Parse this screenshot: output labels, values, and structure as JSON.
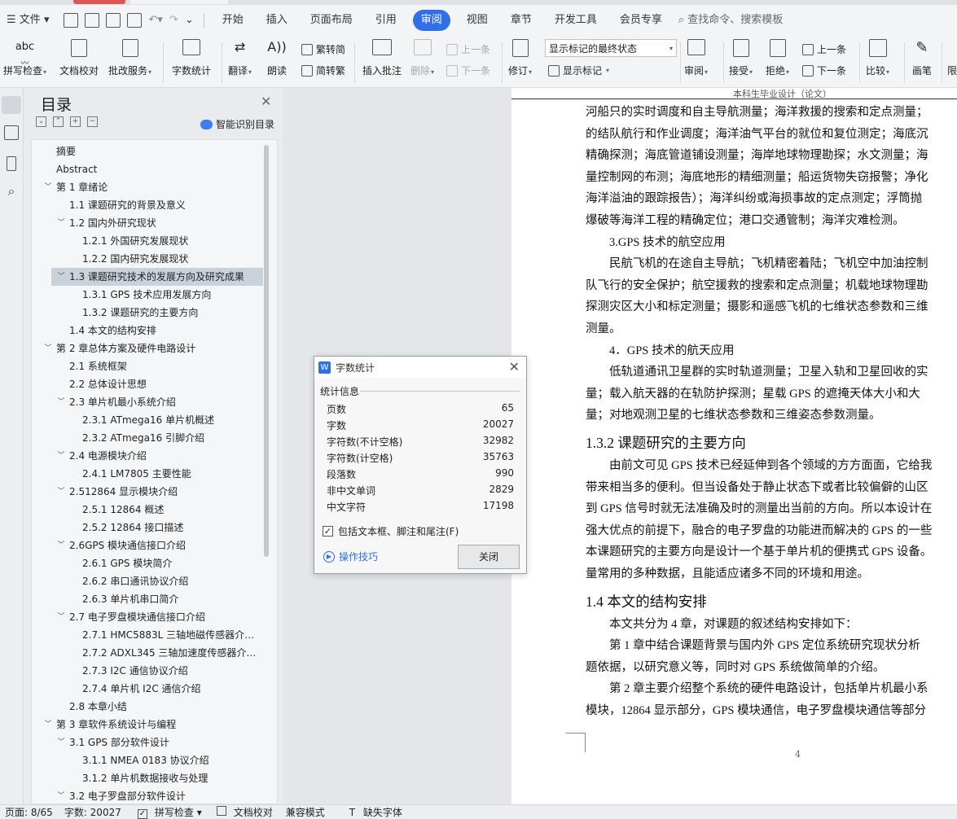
{
  "menubar": {
    "file": "文件",
    "items": [
      "开始",
      "插入",
      "页面布局",
      "引用",
      "审阅",
      "视图",
      "章节",
      "开发工具",
      "会员专享"
    ],
    "active_index": 4,
    "search": "查找命令、搜索模板"
  },
  "ribbon": {
    "spellcheck": "拼写检查",
    "proofread": "文档校对",
    "batch": "批改服务",
    "wordcount": "字数统计",
    "translate": "翻译",
    "read": "朗读",
    "trad_to_simp": "繁转简",
    "simp_to_trad": "简转繁",
    "insert_comment": "插入批注",
    "delete": "删除",
    "prev": "上一条",
    "next": "下一条",
    "revise": "修订",
    "show_select": "显示标记的最终状态",
    "show_markup": "显示标记",
    "review": "审阅",
    "accept": "接受",
    "reject": "拒绝",
    "prev2": "上一条",
    "next2": "下一条",
    "compare": "比较",
    "pen": "画笔",
    "limit": "限"
  },
  "toc": {
    "title": "目录",
    "smart": "智能识别目录",
    "items": [
      {
        "label": "摘要",
        "level": 0,
        "expand": ""
      },
      {
        "label": "Abstract",
        "level": 0,
        "expand": ""
      },
      {
        "label": "第 1 章绪论",
        "level": 0,
        "expand": "v"
      },
      {
        "label": "1.1 课题研究的背景及意义",
        "level": 1,
        "expand": ""
      },
      {
        "label": "1.2 国内外研究现状",
        "level": 1,
        "expand": "v"
      },
      {
        "label": "1.2.1 外国研究发展现状",
        "level": 2,
        "expand": ""
      },
      {
        "label": "1.2.2 国内研究发展现状",
        "level": 2,
        "expand": ""
      },
      {
        "label": "1.3 课题研究技术的发展方向及研究成果",
        "level": 1,
        "expand": "v",
        "selected": true
      },
      {
        "label": "1.3.1 GPS 技术应用发展方向",
        "level": 2,
        "expand": ""
      },
      {
        "label": "1.3.2 课题研究的主要方向",
        "level": 2,
        "expand": ""
      },
      {
        "label": "1.4 本文的结构安排",
        "level": 1,
        "expand": ""
      },
      {
        "label": "第 2 章总体方案及硬件电路设计",
        "level": 0,
        "expand": "v"
      },
      {
        "label": "2.1 系统框架",
        "level": 1,
        "expand": ""
      },
      {
        "label": "2.2 总体设计思想",
        "level": 1,
        "expand": ""
      },
      {
        "label": "2.3 单片机最小系统介绍",
        "level": 1,
        "expand": "v"
      },
      {
        "label": "2.3.1 ATmega16 单片机概述",
        "level": 2,
        "expand": ""
      },
      {
        "label": "2.3.2 ATmega16 引脚介绍",
        "level": 2,
        "expand": ""
      },
      {
        "label": "2.4 电源模块介绍",
        "level": 1,
        "expand": "v"
      },
      {
        "label": "2.4.1 LM7805 主要性能",
        "level": 2,
        "expand": ""
      },
      {
        "label": "2.512864 显示模块介绍",
        "level": 1,
        "expand": "v"
      },
      {
        "label": "2.5.1 12864 概述",
        "level": 2,
        "expand": ""
      },
      {
        "label": "2.5.2 12864 接口描述",
        "level": 2,
        "expand": ""
      },
      {
        "label": "2.6GPS 模块通信接口介绍",
        "level": 1,
        "expand": "v"
      },
      {
        "label": "2.6.1 GPS 模块简介",
        "level": 2,
        "expand": ""
      },
      {
        "label": "2.6.2 串口通讯协议介绍",
        "level": 2,
        "expand": ""
      },
      {
        "label": "2.6.3 单片机串口简介",
        "level": 2,
        "expand": ""
      },
      {
        "label": "2.7 电子罗盘模块通信接口介绍",
        "level": 1,
        "expand": "v"
      },
      {
        "label": "2.7.1 HMC5883L 三轴地磁传感器介…",
        "level": 2,
        "expand": ""
      },
      {
        "label": "2.7.2 ADXL345 三轴加速度传感器介…",
        "level": 2,
        "expand": ""
      },
      {
        "label": "2.7.3 I2C 通信协议介绍",
        "level": 2,
        "expand": ""
      },
      {
        "label": "2.7.4 单片机 I2C 通信介绍",
        "level": 2,
        "expand": ""
      },
      {
        "label": "2.8 本章小结",
        "level": 1,
        "expand": ""
      },
      {
        "label": "第 3 章软件系统设计与编程",
        "level": 0,
        "expand": "v"
      },
      {
        "label": "3.1 GPS 部分软件设计",
        "level": 1,
        "expand": "v"
      },
      {
        "label": "3.1.1 NMEA 0183 协议介绍",
        "level": 2,
        "expand": ""
      },
      {
        "label": "3.1.2 单片机数据接收与处理",
        "level": 2,
        "expand": ""
      },
      {
        "label": "3.2 电子罗盘部分软件设计",
        "level": 1,
        "expand": "v"
      }
    ]
  },
  "dialog": {
    "title": "字数统计",
    "section": "统计信息",
    "stats": [
      {
        "label": "页数",
        "value": "65"
      },
      {
        "label": "字数",
        "value": "20027"
      },
      {
        "label": "字符数(不计空格)",
        "value": "32982"
      },
      {
        "label": "字符数(计空格)",
        "value": "35763"
      },
      {
        "label": "段落数",
        "value": "990"
      },
      {
        "label": "非中文单词",
        "value": "2829"
      },
      {
        "label": "中文字符",
        "value": "17198"
      }
    ],
    "include": "包括文本框、脚注和尾注(F)",
    "tips": "操作技巧",
    "close": "关闭"
  },
  "document": {
    "header": "本科生毕业设计（论文）",
    "page_number": "4",
    "lines": [
      {
        "text": "河船只的实时调度和自主导航测量；海洋救援的搜索和定点测量；",
        "kind": "p"
      },
      {
        "text": "的结队航行和作业调度；海洋油气平台的就位和复位测定；海底沉",
        "kind": "p"
      },
      {
        "text": "精确探测；海底管道铺设测量；海岸地球物理勘探；水文测量；海",
        "kind": "p"
      },
      {
        "text": "量控制网的布测；海底地形的精细测量；船运货物失窃报警；净化",
        "kind": "p"
      },
      {
        "text": "海洋溢油的跟踪报告）；海洋纠纷或海损事故的定点测定；浮筒抛",
        "kind": "p"
      },
      {
        "text": "爆破等海洋工程的精确定位；港口交通管制；海洋灾难检测。",
        "kind": "p"
      },
      {
        "text": "　　3.GPS 技术的航空应用",
        "kind": "p"
      },
      {
        "text": "　　民航飞机的在途自主导航；飞机精密着陆；飞机空中加油控制",
        "kind": "p"
      },
      {
        "text": "队飞行的安全保护；航空援救的搜索和定点测量；机载地球物理勘",
        "kind": "p"
      },
      {
        "text": "探测灾区大小和标定测量；摄影和遥感飞机的七维状态参数和三维",
        "kind": "p"
      },
      {
        "text": "测量。",
        "kind": "p"
      },
      {
        "text": "　　4．GPS 技术的航天应用",
        "kind": "p"
      },
      {
        "text": "　　低轨道通讯卫星群的实时轨道测量；卫星入轨和卫星回收的实",
        "kind": "p"
      },
      {
        "text": "量；载入航天器的在轨防护探测；星载 GPS 的遮掩天体大小和大",
        "kind": "p"
      },
      {
        "text": "量；对地观测卫星的七维状态参数和三维姿态参数测量。",
        "kind": "p"
      },
      {
        "text": "1.3.2 课题研究的主要方向",
        "kind": "h"
      },
      {
        "text": "　　由前文可见 GPS 技术已经延伸到各个领域的方方面面，它给我",
        "kind": "p"
      },
      {
        "text": "带来相当多的便利。但当设备处于静止状态下或者比较偏僻的山区",
        "kind": "p"
      },
      {
        "text": "到 GPS 信号时就无法准确及时的测量出当前的方向。所以本设计在",
        "kind": "p"
      },
      {
        "text": "强大优点的前提下，融合的电子罗盘的功能进而解决的 GPS 的一些",
        "kind": "p"
      },
      {
        "text": "本课题研究的主要方向是设计一个基于单片机的便携式 GPS 设备。",
        "kind": "p"
      },
      {
        "text": "量常用的多种数据，且能适应诸多不同的环境和用途。",
        "kind": "p"
      },
      {
        "text": "1.4 本文的结构安排",
        "kind": "h"
      },
      {
        "text": "　　本文共分为 4 章，对课题的叙述结构安排如下：",
        "kind": "p"
      },
      {
        "text": "　　第 1 章中结合课题背景与国内外 GPS 定位系统研究现状分析",
        "kind": "p"
      },
      {
        "text": "题依据，以研究意义等，同时对 GPS 系统做简单的介绍。",
        "kind": "p"
      },
      {
        "text": "　　第 2 章主要介绍整个系统的硬件电路设计，包括单片机最小系",
        "kind": "p"
      },
      {
        "text": "模块，12864 显示部分，GPS 模块通信，电子罗盘模块通信等部分",
        "kind": "p"
      }
    ]
  },
  "status": {
    "page": "页面: 8/65",
    "words": "字数: 20027",
    "spell": "拼写检查",
    "proof": "文档校对",
    "compat": "兼容模式",
    "missing_font": "缺失字体"
  }
}
